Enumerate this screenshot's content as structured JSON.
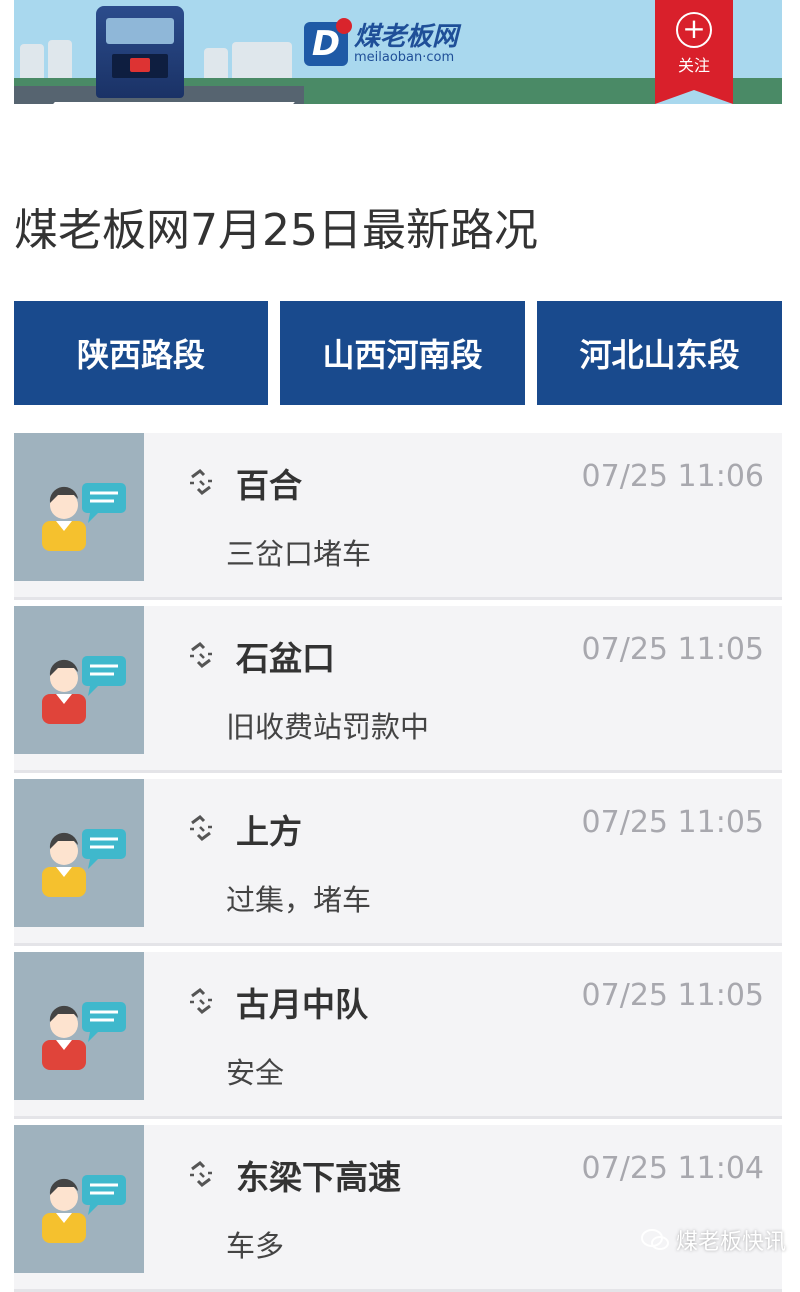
{
  "banner": {
    "brand_cn": "煤老板网",
    "brand_en": "meilaoban·com",
    "follow_label": "关注",
    "colors": {
      "sky": "#a9d8ee",
      "brand_blue": "#1f4f98",
      "follow_red": "#d9202b"
    }
  },
  "page_title": "煤老板网7月25日最新路况",
  "tabs": [
    {
      "label": "陕西路段"
    },
    {
      "label": "山西河南段"
    },
    {
      "label": "河北山东段"
    }
  ],
  "tab_color": "#194a8d",
  "reports": [
    {
      "location": "百合",
      "time": "07/25 11:06",
      "desc": "三岔口堵车",
      "avatar": "user-yellow-shirt-icon"
    },
    {
      "location": "石盆口",
      "time": "07/25 11:05",
      "desc": "旧收费站罚款中",
      "avatar": "user-red-shirt-icon"
    },
    {
      "location": "上方",
      "time": "07/25 11:05",
      "desc": "过集，堵车",
      "avatar": "user-yellow-shirt-icon"
    },
    {
      "location": "古月中队",
      "time": "07/25 11:05",
      "desc": "安全",
      "avatar": "user-red-shirt-icon"
    },
    {
      "location": "东梁下高速",
      "time": "07/25 11:04",
      "desc": "车多",
      "avatar": "user-yellow-shirt-icon"
    }
  ],
  "watermark": "煤老板快讯"
}
